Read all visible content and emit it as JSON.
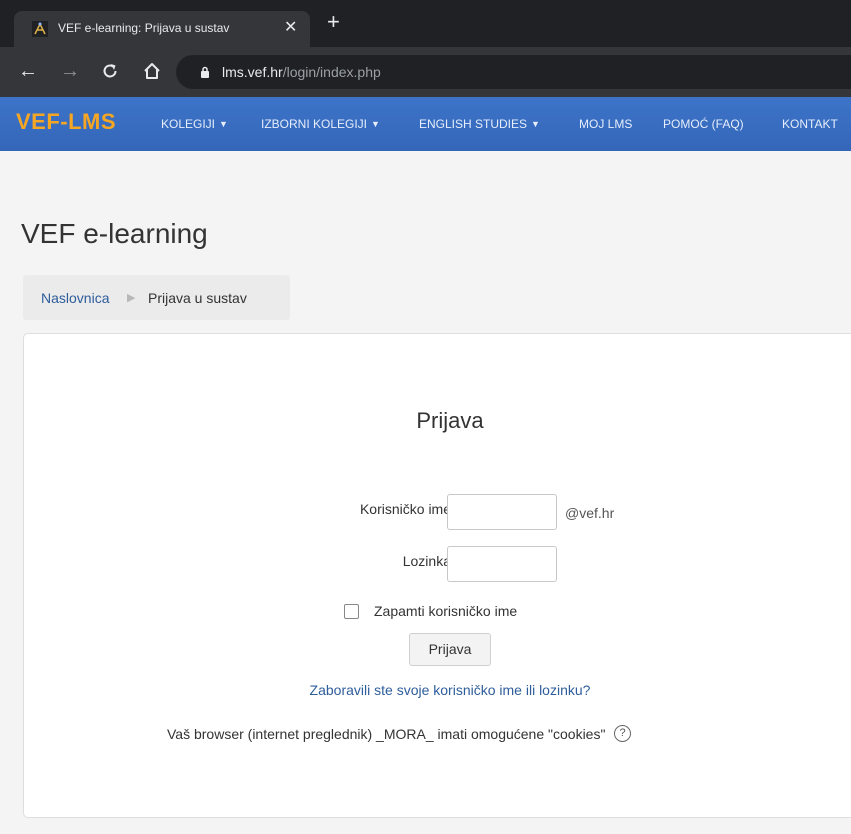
{
  "browser": {
    "tab_title": "VEF e-learning: Prijava u sustav",
    "tab_close": "✕",
    "new_tab": "+",
    "url_host": "lms.vef.hr",
    "url_path": "/login/index.php",
    "icons": [
      "back-arrow-icon",
      "forward-arrow-icon",
      "reload-icon",
      "home-icon",
      "lock-icon"
    ]
  },
  "navbar": {
    "brand": "VEF-LMS",
    "items": [
      {
        "label": "KOLEGIJI",
        "dropdown": true
      },
      {
        "label": "IZBORNI KOLEGIJI",
        "dropdown": true
      },
      {
        "label": "ENGLISH STUDIES",
        "dropdown": true
      },
      {
        "label": "MOJ LMS",
        "dropdown": false
      },
      {
        "label": "POMOĆ (FAQ)",
        "dropdown": false
      },
      {
        "label": "KONTAKT",
        "dropdown": false
      }
    ],
    "brand_color": "#f5a623",
    "bar_color": "#3a6fc4"
  },
  "page": {
    "title": "VEF e-learning",
    "breadcrumb": {
      "home": "Naslovnica",
      "current": "Prijava u sustav"
    }
  },
  "login": {
    "heading": "Prijava",
    "username_label": "Korisničko ime",
    "username_value": "",
    "username_suffix": "@vef.hr",
    "password_label": "Lozinka",
    "password_value": "",
    "remember_label": "Zapamti korisničko ime",
    "remember_checked": false,
    "submit_label": "Prijava",
    "forgot_link": "Zaboravili ste svoje korisničko ime ili lozinku?",
    "cookies_notice": "Vaš browser (internet preglednik) _MORA_ imati omogućene \"cookies\"",
    "help_icon": "?",
    "link_color": "#2d5d9b"
  }
}
